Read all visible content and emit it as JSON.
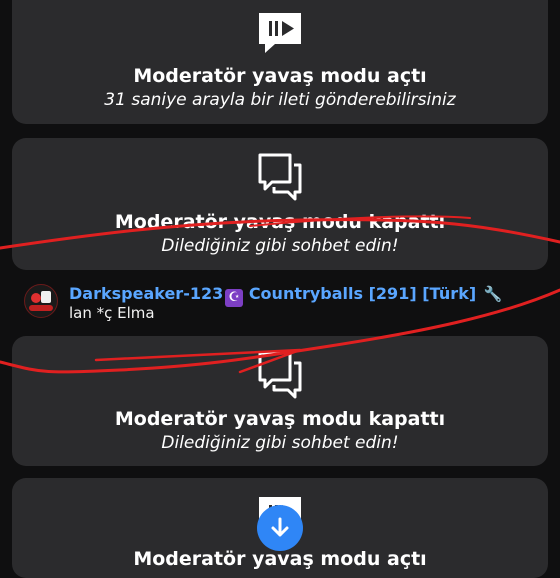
{
  "cards": [
    {
      "icon": "slow-mode-icon",
      "title": "Moderatör yavaş modu açtı",
      "subtitle": "31 saniye arayla bir ileti gönderebilirsiniz"
    },
    {
      "icon": "chat-bubbles-icon",
      "title": "Moderatör yavaş modu kapattı",
      "subtitle": "Dilediğiniz gibi sohbet edin!"
    },
    {
      "icon": "chat-bubbles-icon",
      "title": "Moderatör yavaş modu kapattı",
      "subtitle": "Dilediğiniz gibi sohbet edin!"
    },
    {
      "icon": "slow-mode-icon",
      "title": "Moderatör yavaş modu açtı"
    }
  ],
  "chat_message": {
    "username": "Darkspeaker-123",
    "badge_icon": "moon-emoji-icon",
    "group": "Countryballs [291] [Türk]",
    "role_icon": "wrench-icon",
    "text": "lan *ç Elma"
  },
  "scroll_button": {
    "icon": "arrow-down-icon"
  },
  "colors": {
    "background": "#0f0f10",
    "card": "#2b2b2d",
    "username": "#5aa6ff",
    "accent": "#2f86f6",
    "annotation": "#e02020"
  }
}
